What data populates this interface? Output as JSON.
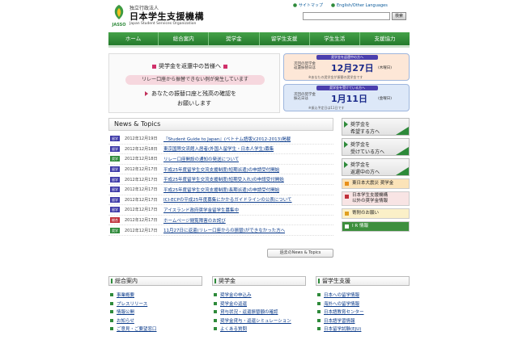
{
  "header": {
    "org_small": "独立行政法人",
    "org_name": "日本学生支援機構",
    "org_en": "Japan Student Services Organization",
    "logo_text": "JASSO",
    "links": [
      "サイトマップ",
      "English/Other Languages"
    ],
    "search_button": "検索",
    "search_value": ""
  },
  "nav": [
    "ホーム",
    "総合案内",
    "奨学金",
    "留学生支援",
    "学生生活",
    "支援協力"
  ],
  "banner_left": {
    "title": "奨学金を返還中の皆様へ",
    "pill": "リレー口座から振替できない例が発生しています",
    "line1": "あなたの振替口座と残高の確認を",
    "line2": "お願いします"
  },
  "banner_right": [
    {
      "head": "奨学金を返還中の方へ",
      "label1": "次回の奨学金",
      "label2": "返還振替日は",
      "date": "12月27日",
      "dow": "(木曜日)",
      "note": "※あなたの奨学金が振替の奨学金です"
    },
    {
      "head": "奨学金を受けている方へ",
      "label1": "次回の奨学金",
      "label2": "振込日は",
      "date": "1月11日",
      "dow": "(金曜日)",
      "note": "※振込予定日は11日です"
    }
  ],
  "news": {
    "title": "News & Topics",
    "items": [
      {
        "badge": "留学",
        "date": "2012年12月19日",
        "text": "『Student Guide to Japan』(ベトナム語版)(2012-2013)掲載"
      },
      {
        "badge": "留学",
        "date": "2012年12月18日",
        "text": "東京国際交流館入居者(外国人留学生・日本人学生)募集"
      },
      {
        "badge": "奨学",
        "date": "2012年12月18日",
        "text": "リレー口座開設の通知の発送について"
      },
      {
        "badge": "留学",
        "date": "2012年12月17日",
        "text": "平成25年度留学生交流支援制度(短期派遣)の申請受付開始"
      },
      {
        "badge": "留学",
        "date": "2012年12月17日",
        "text": "平成25年度留学生交流支援制度(短期受入れ)の申請受付開始"
      },
      {
        "badge": "留学",
        "date": "2012年12月17日",
        "text": "平成25年度留学生交流支援制度(長期派遣)の申請受付開始"
      },
      {
        "badge": "留学",
        "date": "2012年12月17日",
        "text": "ICI-ECPの平成25年度募集にかかるガイドラインの公表について"
      },
      {
        "badge": "留学",
        "date": "2012年12月17日",
        "text": "アイスランド政府奨学金留学生募集中"
      },
      {
        "badge": "総合",
        "date": "2012年12月17日",
        "text": "ホームページ閲覧障害のお詫び"
      },
      {
        "badge": "奨学",
        "date": "2012年12月17日",
        "text": "11月27日に返還(リレー口座からの振替)ができなかった方へ"
      }
    ],
    "more": "過去のNews & Topics"
  },
  "right_buttons": [
    {
      "line1": "奨学金を",
      "line2": "希望する方へ"
    },
    {
      "line1": "奨学金を",
      "line2": "受けている方へ"
    },
    {
      "line1": "奨学金を",
      "line2": "返還中の方へ"
    }
  ],
  "side_links": [
    {
      "label": "東日本大震災 奨学金",
      "color": "#f6b94a"
    },
    {
      "label": "日本学生支援機構",
      "label2": "以外の奨学金情報",
      "color": "#f3d2d2"
    },
    {
      "label": "寄附のお願い",
      "color": "#f7e2a8"
    },
    {
      "label": "I R 情報",
      "color": "#3d8f3d"
    }
  ],
  "bottom": [
    {
      "title": "総合案内",
      "items": [
        "事業概要",
        "プレスリリース",
        "情報公開",
        "お知らせ",
        "ご意見・ご要望窓口"
      ]
    },
    {
      "title": "奨学金",
      "items": [
        "奨学金の申込み",
        "奨学金の返還",
        "貸与状況・返還振替額の確認",
        "奨学金貸与・返還シミュレーション",
        "よくある質問"
      ]
    },
    {
      "title": "留学生支援",
      "items": [
        "日本への留学情報",
        "海外への留学情報",
        "日本語教育センター",
        "日本語学習情報",
        "日本留学試験(EJU)"
      ]
    }
  ],
  "colors": {
    "nav_green": "#2e8a3a",
    "badge_ryugaku": "#3e3aa8",
    "badge_shogaku": "#2e8a3a",
    "badge_sogo": "#c0303a"
  }
}
